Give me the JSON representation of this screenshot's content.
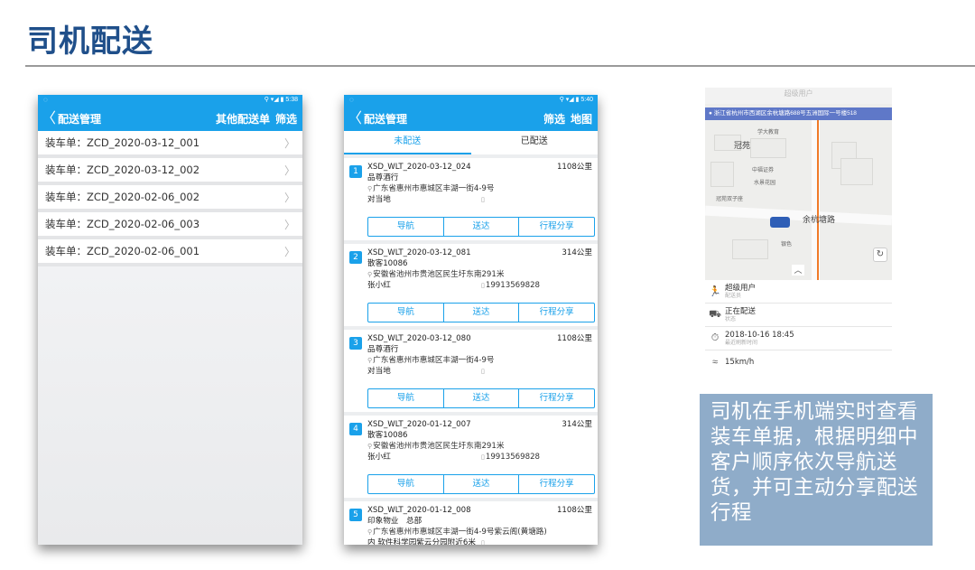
{
  "slide": {
    "title": "司机配送"
  },
  "phone1": {
    "status_time": "5:38",
    "nav": {
      "back": "〈",
      "title": "配送管理",
      "action1": "其他配送单",
      "action2": "筛选"
    },
    "loads": [
      "装车单：ZCD_2020-03-12_001",
      "装车单：ZCD_2020-03-12_002",
      "装车单：ZCD_2020-02-06_002",
      "装车单：ZCD_2020-02-06_003",
      "装车单：ZCD_2020-02-06_001"
    ]
  },
  "phone2": {
    "status_time": "5:40",
    "nav": {
      "back": "〈",
      "title": "配送管理",
      "action1": "筛选",
      "action2": "地图"
    },
    "tabs": [
      "未配送",
      "已配送"
    ],
    "buttons": [
      "导航",
      "送达",
      "行程分享"
    ],
    "orders": [
      {
        "num": "1",
        "code": "XSD_WLT_2020-03-12_024",
        "distance": "1108公里",
        "name": "品尊酒行",
        "address": "广东省惠州市惠城区丰湖一街4-9号",
        "contact": "对当地",
        "phone": ""
      },
      {
        "num": "2",
        "code": "XSD_WLT_2020-03-12_081",
        "distance": "314公里",
        "name": "散客10086",
        "address": "安徽省池州市贵池区民生圩东南291米",
        "contact": "张小红",
        "phone": "19913569828"
      },
      {
        "num": "3",
        "code": "XSD_WLT_2020-03-12_080",
        "distance": "1108公里",
        "name": "品尊酒行",
        "address": "广东省惠州市惠城区丰湖一街4-9号",
        "contact": "对当地",
        "phone": ""
      },
      {
        "num": "4",
        "code": "XSD_WLT_2020-01-12_007",
        "distance": "314公里",
        "name": "散客10086",
        "address": "安徽省池州市贵池区民生圩东南291米",
        "contact": "张小红",
        "phone": "19913569828"
      },
      {
        "num": "5",
        "code": "XSD_WLT_2020-01-12_008",
        "distance": "1108公里",
        "name": "印象物业　总部",
        "address": "广东省惠州市惠城区丰湖一街4-9号紫云阁(黄塘路)",
        "contact": "内 软件科学园紫云分园附近6米",
        "phone": ""
      }
    ]
  },
  "phone3": {
    "top_title": "超级用户",
    "address": "浙江省杭州市西湖区余杭塘路688号五洲国际一号楼518",
    "labels": {
      "school": "学大教育",
      "area": "冠苑",
      "securities": "中福证券",
      "lakeshore": "水景花园",
      "ring": "冠苑双子座",
      "street": "余杭塘路",
      "bank": "银色"
    },
    "info": [
      {
        "icon": "runner-icon",
        "value": "超级用户",
        "label": "配送员"
      },
      {
        "icon": "truck-icon",
        "value": "正在配送",
        "label": "状态"
      },
      {
        "icon": "timer-icon",
        "value": "2018-10-16 18:45",
        "label": "最近刷新时间"
      },
      {
        "icon": "speed-icon",
        "value": "15km/h",
        "label": ""
      }
    ]
  },
  "description": "司机在手机端实时查看装车单据，根据明细中客户顺序依次导航送货，并可主动分享配送行程"
}
